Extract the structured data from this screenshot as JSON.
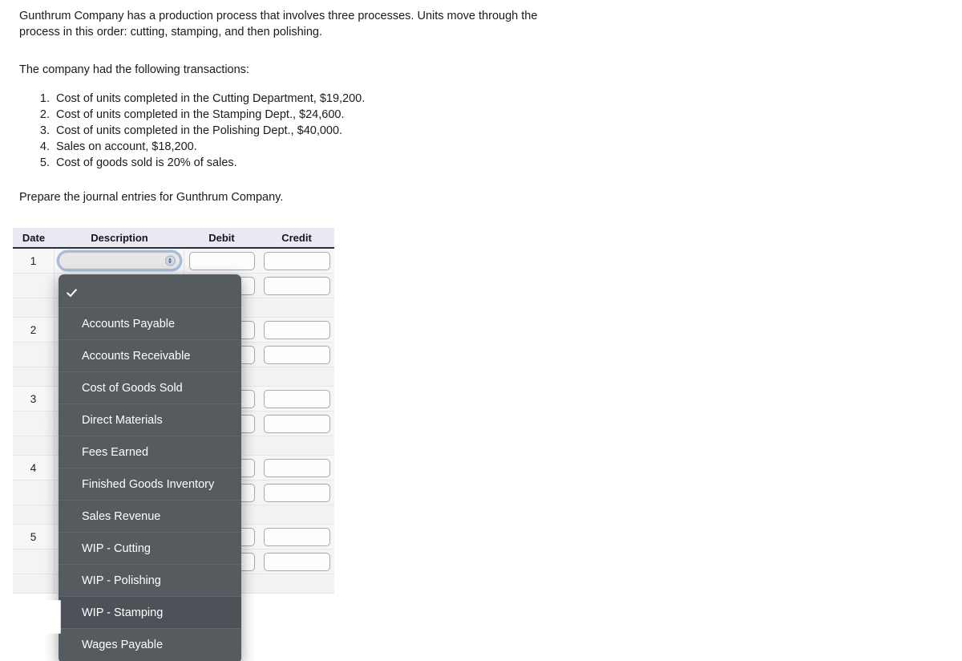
{
  "problem": {
    "intro": "Gunthrum Company has a production process that involves three processes. Units move through the process in this order: cutting, stamping, and then polishing.",
    "transactions_lead": "The company had the following transactions:",
    "transactions": [
      {
        "num": "1.",
        "text": "Cost of units completed in the Cutting Department, $19,200."
      },
      {
        "num": "2.",
        "text": "Cost of units completed in the Stamping Dept., $24,600."
      },
      {
        "num": "3.",
        "text": "Cost of units completed in the Polishing Dept., $40,000."
      },
      {
        "num": "4.",
        "text": "Sales on account, $18,200."
      },
      {
        "num": "5.",
        "text": "Cost of goods sold is 20% of sales."
      }
    ],
    "instruction": "Prepare the journal entries for Gunthrum Company."
  },
  "journal": {
    "columns": {
      "date": "Date",
      "description": "Description",
      "debit": "Debit",
      "credit": "Credit"
    },
    "entries": [
      {
        "number": "1",
        "lines": 2
      },
      {
        "number": "2",
        "lines": 2
      },
      {
        "number": "3",
        "lines": 2
      },
      {
        "number": "4",
        "lines": 2
      },
      {
        "number": "5",
        "lines": 2
      }
    ],
    "account_select": {
      "value": "",
      "state": "focused-open"
    },
    "amount_fields": {
      "debit_value": "",
      "credit_value": ""
    }
  },
  "dropdown": {
    "open": true,
    "selected_index": 0,
    "highlighted_label": "WIP - Stamping",
    "items": [
      {
        "label": "",
        "checked": true
      },
      {
        "label": "Accounts Payable",
        "checked": false
      },
      {
        "label": "Accounts Receivable",
        "checked": false
      },
      {
        "label": "Cost of Goods Sold",
        "checked": false
      },
      {
        "label": "Direct Materials",
        "checked": false
      },
      {
        "label": "Fees Earned",
        "checked": false
      },
      {
        "label": "Finished Goods Inventory",
        "checked": false
      },
      {
        "label": "Sales Revenue",
        "checked": false
      },
      {
        "label": "WIP - Cutting",
        "checked": false
      },
      {
        "label": "WIP - Polishing",
        "checked": false
      },
      {
        "label": "WIP - Stamping",
        "checked": false
      },
      {
        "label": "Wages Payable",
        "checked": false
      }
    ]
  },
  "colors": {
    "header_bg": "#e9e9f2",
    "menu_bg": "#565b5f",
    "menu_highlight": "#4c5258",
    "focus_ring": "#78a0d7",
    "page_bg": "#ffffff"
  }
}
